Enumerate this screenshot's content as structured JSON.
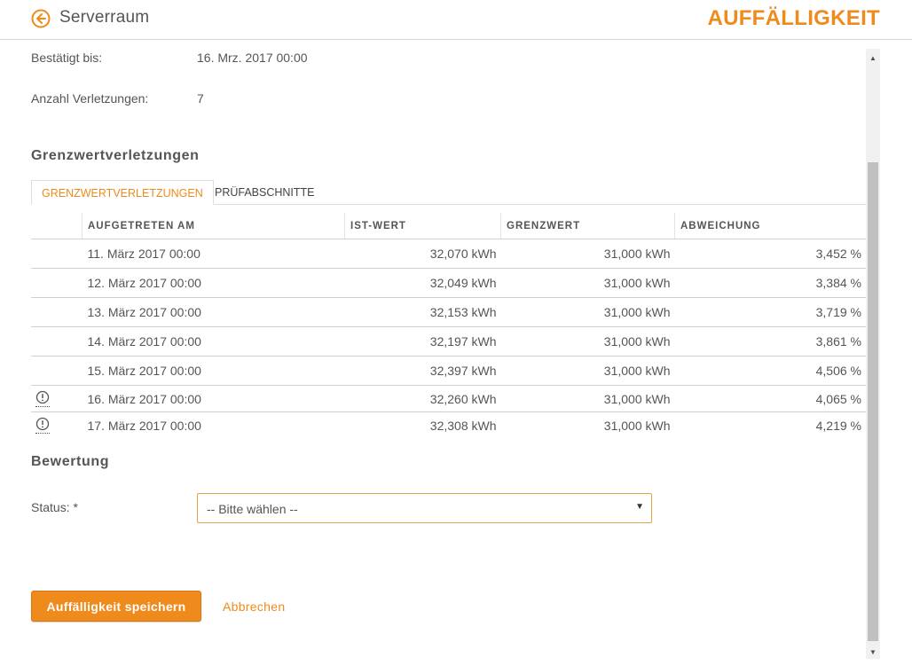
{
  "header": {
    "back_icon": "arrow-left-circle-icon",
    "title": "Serverraum",
    "right_title": "AUFFÄLLIGKEIT",
    "accent_color": "#ef8a1c"
  },
  "details": {
    "confirmed_label": "Bestätigt bis:",
    "confirmed_value": "16. Mrz. 2017 00:00",
    "violations_label": "Anzahl Verletzungen:",
    "violations_value": "7"
  },
  "limits_section": {
    "title": "Grenzwertverletzungen",
    "tabs": [
      {
        "label": "GRENZWERTVERLETZUNGEN",
        "active": true
      },
      {
        "label": "PRÜFABSCHNITTE",
        "active": false
      }
    ],
    "columns": [
      "AUFGETRETEN AM",
      "IST-WERT",
      "GRENZWERT",
      "ABWEICHUNG"
    ],
    "rows": [
      {
        "warning": false,
        "date": "11. März 2017 00:00",
        "actual": "32,070 kWh",
        "limit": "31,000 kWh",
        "deviation": "3,452 %"
      },
      {
        "warning": false,
        "date": "12. März 2017 00:00",
        "actual": "32,049 kWh",
        "limit": "31,000 kWh",
        "deviation": "3,384 %"
      },
      {
        "warning": false,
        "date": "13. März 2017 00:00",
        "actual": "32,153 kWh",
        "limit": "31,000 kWh",
        "deviation": "3,719 %"
      },
      {
        "warning": false,
        "date": "14. März 2017 00:00",
        "actual": "32,197 kWh",
        "limit": "31,000 kWh",
        "deviation": "3,861 %"
      },
      {
        "warning": false,
        "date": "15. März 2017 00:00",
        "actual": "32,397 kWh",
        "limit": "31,000 kWh",
        "deviation": "4,506 %"
      },
      {
        "warning": true,
        "date": "16. März 2017 00:00",
        "actual": "32,260 kWh",
        "limit": "31,000 kWh",
        "deviation": "4,065 %"
      },
      {
        "warning": true,
        "date": "17. März 2017 00:00",
        "actual": "32,308 kWh",
        "limit": "31,000 kWh",
        "deviation": "4,219 %"
      }
    ]
  },
  "rating_section": {
    "title": "Bewertung",
    "status_label": "Status: *",
    "status_selected": "-- Bitte wählen --"
  },
  "actions": {
    "save_label": "Auffälligkeit speichern",
    "cancel_label": "Abbrechen"
  }
}
